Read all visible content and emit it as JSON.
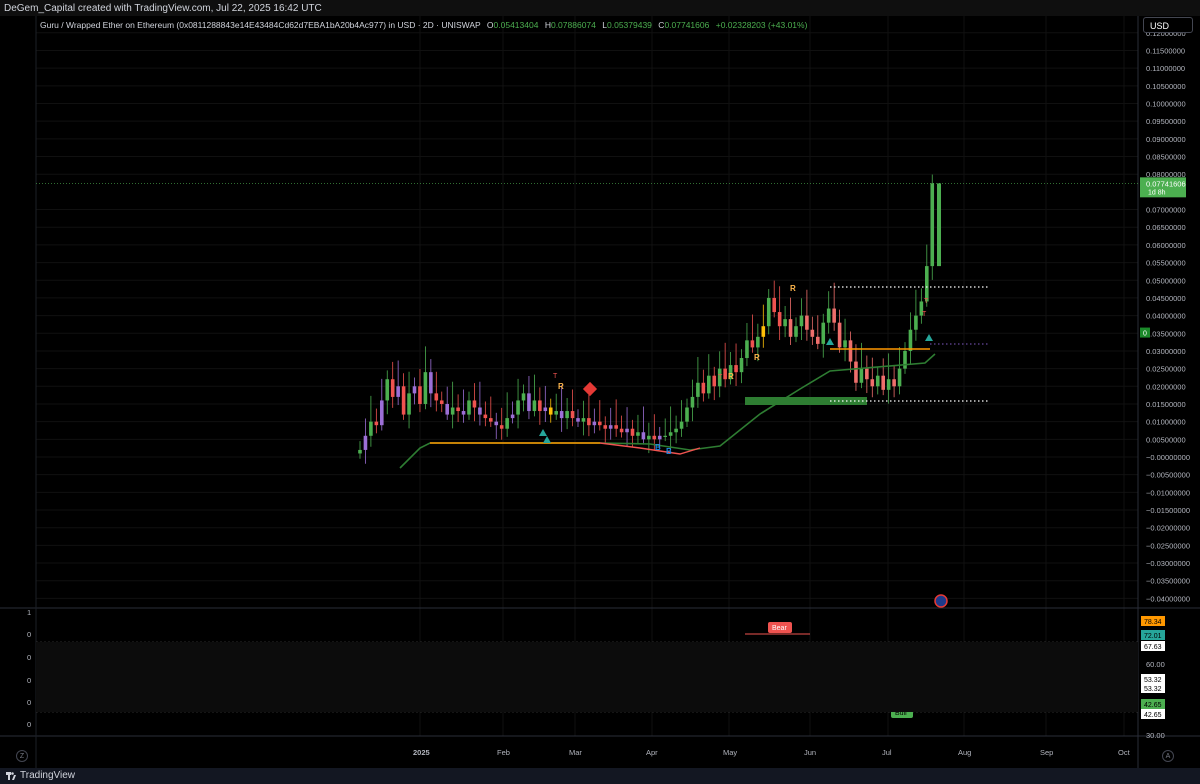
{
  "header": {
    "attribution": "DeGem_Capital created with TradingView.com, Jul 22, 2025 16:42 UTC"
  },
  "legend": {
    "symbol": "Guru / Wrapped Ether on Ethereum (0x0811288843e14E43484Cd62d7EBA1bA20b4Ac977) in USD · 2D · UNISWAP",
    "open_label": "O",
    "open": "0.05413404",
    "high_label": "H",
    "high": "0.07886074",
    "low_label": "L",
    "low": "0.05379439",
    "close_label": "C",
    "close": "0.07741606",
    "change": "+0.02328203 (+43.01%)"
  },
  "currency_button": "USD",
  "colors": {
    "up": "#4caf50",
    "down": "#ef5350",
    "purple": "#9c6fd6",
    "orange": "#ff9800",
    "trend": "#2e7d32",
    "osc_fast": "#ff9800",
    "osc_slow": "#26a69a"
  },
  "price_axis": {
    "ticks": [
      "0.12000000",
      "0.11500000",
      "0.11000000",
      "0.10500000",
      "0.10000000",
      "0.09500000",
      "0.09000000",
      "0.08500000",
      "0.08000000",
      "0.07000000",
      "0.06500000",
      "0.06000000",
      "0.05500000",
      "0.05000000",
      "0.04500000",
      "0.04000000",
      "0.03500000",
      "0.03000000",
      "0.02500000",
      "0.02000000",
      "0.01500000",
      "0.01000000",
      "0.00500000",
      "−0.00000000",
      "−0.00500000",
      "−0.01000000",
      "−0.01500000",
      "−0.02000000",
      "−0.02500000",
      "−0.03000000",
      "−0.03500000",
      "−0.04000000"
    ],
    "last_price": "0.07741606",
    "last_countdown": "1d 8h",
    "marker_zero": "0"
  },
  "osc_axis": {
    "left_ticks": [
      "1",
      "0",
      "0",
      "0",
      "0",
      "0"
    ],
    "right_ticks": [
      "60.00",
      "30.00"
    ],
    "badges": [
      {
        "value": "78.34",
        "color": "#ff9800",
        "text_color": "#000"
      },
      {
        "value": "72.01",
        "color": "#26a69a",
        "text_color": "#000"
      },
      {
        "value": "67.63",
        "color": "#ffffff",
        "text_color": "#000"
      },
      {
        "value": "53.32",
        "color": "#ffffff",
        "text_color": "#000"
      },
      {
        "value": "53.32",
        "color": "#ffffff",
        "text_color": "#000"
      },
      {
        "value": "42.65",
        "color": "#4caf50",
        "text_color": "#000"
      },
      {
        "value": "42.65",
        "color": "#ffffff",
        "text_color": "#000"
      }
    ]
  },
  "time_axis": {
    "labels": [
      "2025",
      "Feb",
      "Mar",
      "Apr",
      "May",
      "Jun",
      "Jul",
      "Aug",
      "Sep",
      "Oct"
    ],
    "bold_label": "2025"
  },
  "markers": {
    "R": "R",
    "T": "T",
    "B": "B",
    "bear": "Bear",
    "bull": "Bull"
  },
  "footer": {
    "brand": "TradingView",
    "left_btn": "Z",
    "right_btn": "A"
  }
}
